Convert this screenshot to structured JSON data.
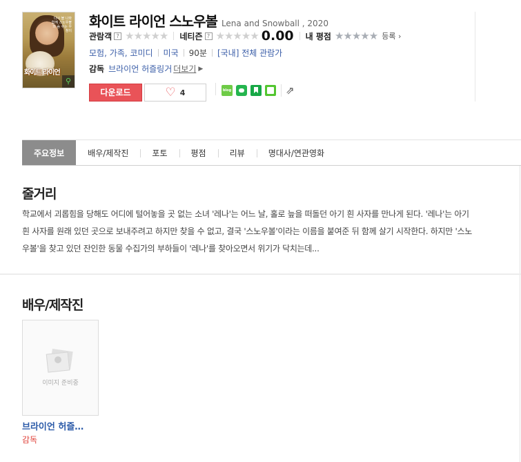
{
  "movie": {
    "title": "화이트 라이언 스노우볼",
    "original_title": "Lena and Snowball , 2020",
    "poster_title": "화이트 라이언",
    "poster_tagline": "다시 볼 나와 함께 스노우볼의 숨 쉬는 우정이"
  },
  "ratings": {
    "audience_label": "관람객",
    "netizen_label": "네티즌",
    "netizen_score": "0.00",
    "my_rating_label": "내 평점",
    "register_label": "등록",
    "help_mark": "?"
  },
  "meta": {
    "genres": "모험, 가족, 코미디",
    "country": "미국",
    "runtime": "90분",
    "grade": "[국내] 전체 관람가"
  },
  "director": {
    "label": "감독",
    "name": "브라이언 허즐링거",
    "more_label": "더보기"
  },
  "actions": {
    "download_label": "다운로드",
    "like_count": "4",
    "blog_icon_text": "blog"
  },
  "tabs": [
    {
      "label": "주요정보",
      "active": true
    },
    {
      "label": "배우/제작진",
      "active": false
    },
    {
      "label": "포토",
      "active": false
    },
    {
      "label": "평점",
      "active": false
    },
    {
      "label": "리뷰",
      "active": false
    },
    {
      "label": "명대사/연관영화",
      "active": false
    }
  ],
  "synopsis": {
    "heading": "줄거리",
    "text": "학교에서 괴롭힘을 당해도 어디에 털어놓을 곳 없는 소녀 '레나'는 어느 날, 홀로 늪을 떠돌던 아기 흰 사자를 만나게 된다. '레나'는 아기 흰 사자를 원래 있던 곳으로 보내주려고 하지만 찾을 수 없고, 결국 '스노우볼'이라는 이름을 붙여준 뒤 함께 살기 시작한다. 하지만 '스노우볼'을 찾고 있던 잔인한 동물 수집가의 부하들이 '레나'를 찾아오면서 위기가 닥치는데..."
  },
  "cast": {
    "heading": "배우/제작진",
    "members": [
      {
        "name": "브라이언 허즐…",
        "role": "감독",
        "placeholder": "이미지 준비중"
      }
    ]
  }
}
